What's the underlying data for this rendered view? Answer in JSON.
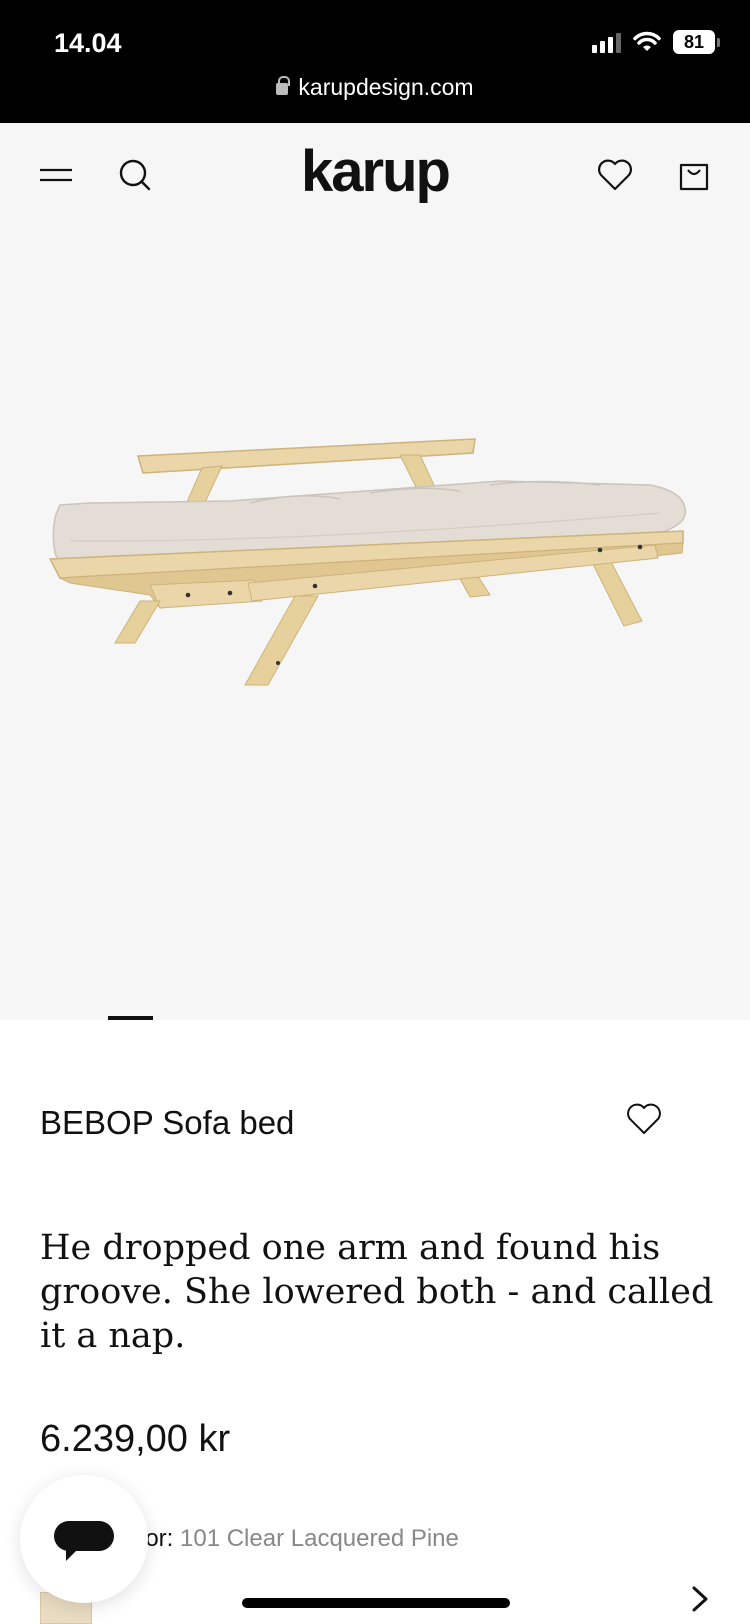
{
  "status": {
    "time": "14.04",
    "battery": "81"
  },
  "browser": {
    "url": "karupdesign.com"
  },
  "header": {
    "logo": "karup",
    "icons": [
      "menu-icon",
      "search-icon",
      "heart-icon",
      "bag-icon"
    ]
  },
  "product": {
    "title": "BEBOP Sofa bed",
    "tagline": "He dropped one arm and found his groove. She lowered both - and called it a nap.",
    "price": "6.239,00 kr",
    "color_label": "lor:",
    "color_value": "101 Clear Lacquered Pine",
    "carousel_position": 1
  },
  "colors": {
    "image_bg": "#f6f6f6",
    "wood": "#e8d3a3",
    "mattress": "#e3ddd5"
  }
}
